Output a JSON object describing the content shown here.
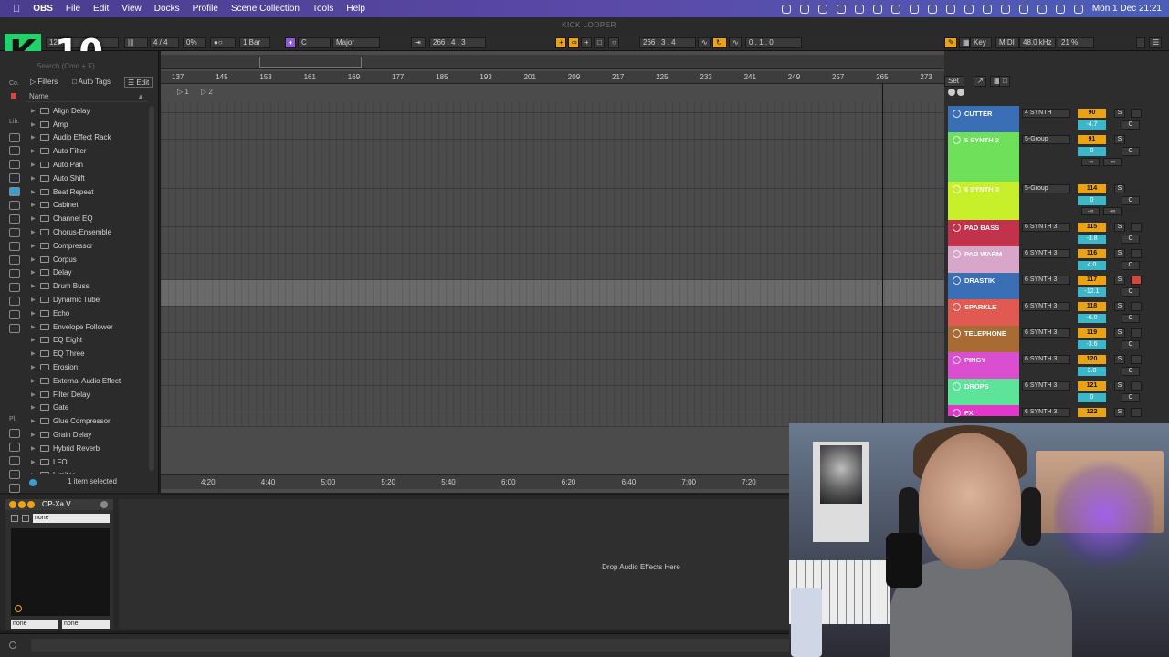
{
  "menubar": {
    "apple": "",
    "app": "OBS",
    "items": [
      "File",
      "Edit",
      "View",
      "Docks",
      "Profile",
      "Scene Collection",
      "Tools",
      "Help"
    ],
    "clock": "Mon 1 Dec  21:21"
  },
  "window": {
    "title": "KICK LOOPER"
  },
  "logo": {
    "letter": "K",
    "number": "10"
  },
  "transport": {
    "tempo": "120.81",
    "signature": "4 / 4",
    "groove": "0%",
    "quantize": "1 Bar",
    "key": "C",
    "scale": "Major",
    "position": "266 .  4 .  3",
    "loop_start": "266 .  3 .  4",
    "loop_length": "0 .  1 .  0",
    "key_label": "Key",
    "midi_label": "MIDI",
    "sample_rate": "48.0 kHz",
    "cpu": "21 %"
  },
  "browser": {
    "search_placeholder": "Search (Cmd + F)",
    "tab_filters": "Filters",
    "tab_autotags": "Auto Tags",
    "tab_edit": "Edit",
    "sidebar_co": "Co.",
    "sidebar_lib": "Lib.",
    "sidebar_pl": "Pl.",
    "name_header": "Name",
    "devices": [
      "Align Delay",
      "Amp",
      "Audio Effect Rack",
      "Auto Filter",
      "Auto Pan",
      "Auto Shift",
      "Beat Repeat",
      "Cabinet",
      "Channel EQ",
      "Chorus-Ensemble",
      "Compressor",
      "Corpus",
      "Delay",
      "Drum Buss",
      "Dynamic Tube",
      "Echo",
      "Envelope Follower",
      "EQ Eight",
      "EQ Three",
      "Erosion",
      "External Audio Effect",
      "Filter Delay",
      "Gate",
      "Glue Compressor",
      "Grain Delay",
      "Hybrid Reverb",
      "LFO",
      "Limiter"
    ],
    "footer": "1 item selected"
  },
  "arrangement": {
    "bar_ticks": [
      "137",
      "145",
      "153",
      "161",
      "169",
      "177",
      "185",
      "193",
      "201",
      "209",
      "217",
      "225",
      "233",
      "241",
      "249",
      "257",
      "265",
      "273"
    ],
    "time_ticks": [
      "4:20",
      "4:40",
      "5:00",
      "5:20",
      "5:40",
      "6:00",
      "6:20",
      "6:40",
      "7:00",
      "7:20"
    ],
    "locators": [
      "1",
      "2"
    ],
    "set_label": "Set"
  },
  "tracks": [
    {
      "name": "CUTTER",
      "color": "#3b6fb5",
      "route": "4 SYNTH",
      "vol": "90",
      "pan": "-4.7",
      "armed": false
    },
    {
      "name": "5 SYNTH 2",
      "color": "#6ee05a",
      "route": "5-Group",
      "vol": "91",
      "pan": "0",
      "armed": false,
      "group": true
    },
    {
      "name": "6 SYNTH 3",
      "color": "#c8f02a",
      "route": "5-Group",
      "vol": "114",
      "pan": "0",
      "armed": false,
      "group": true
    },
    {
      "name": "PAD BASS",
      "color": "#c2324a",
      "route": "6 SYNTH 3",
      "vol": "115",
      "pan": "-3.8",
      "armed": false
    },
    {
      "name": "PAD WARM",
      "color": "#d8a6c8",
      "route": "6 SYNTH 3",
      "vol": "116",
      "pan": "4.0",
      "armed": false
    },
    {
      "name": "DRASTIK",
      "color": "#3b6fb5",
      "route": "6 SYNTH 3",
      "vol": "117",
      "pan": "-12.1",
      "armed": true
    },
    {
      "name": "SPARKLE",
      "color": "#e05a52",
      "route": "6 SYNTH 3",
      "vol": "118",
      "pan": "-6.0",
      "armed": false
    },
    {
      "name": "TELEPHONE",
      "color": "#a86b34",
      "route": "6 SYNTH 3",
      "vol": "119",
      "pan": "-3.6",
      "armed": false
    },
    {
      "name": "PINGY",
      "color": "#d94fd0",
      "route": "6 SYNTH 3",
      "vol": "120",
      "pan": "3.0",
      "armed": false
    },
    {
      "name": "DROPS",
      "color": "#5de39a",
      "route": "6 SYNTH 3",
      "vol": "121",
      "pan": "0",
      "armed": false
    },
    {
      "name": "FX",
      "color": "#e238c8",
      "route": "6 SYNTH 3",
      "vol": "122",
      "pan": "",
      "armed": false
    }
  ],
  "track_buttons": {
    "solo": "S",
    "center": "C",
    "inf": "-∞"
  },
  "device": {
    "name": "OP-Xa V",
    "preset": "none",
    "bottom_left": "none",
    "bottom_right": "none"
  },
  "dropzone": {
    "label": "Drop Audio Effects Here"
  }
}
